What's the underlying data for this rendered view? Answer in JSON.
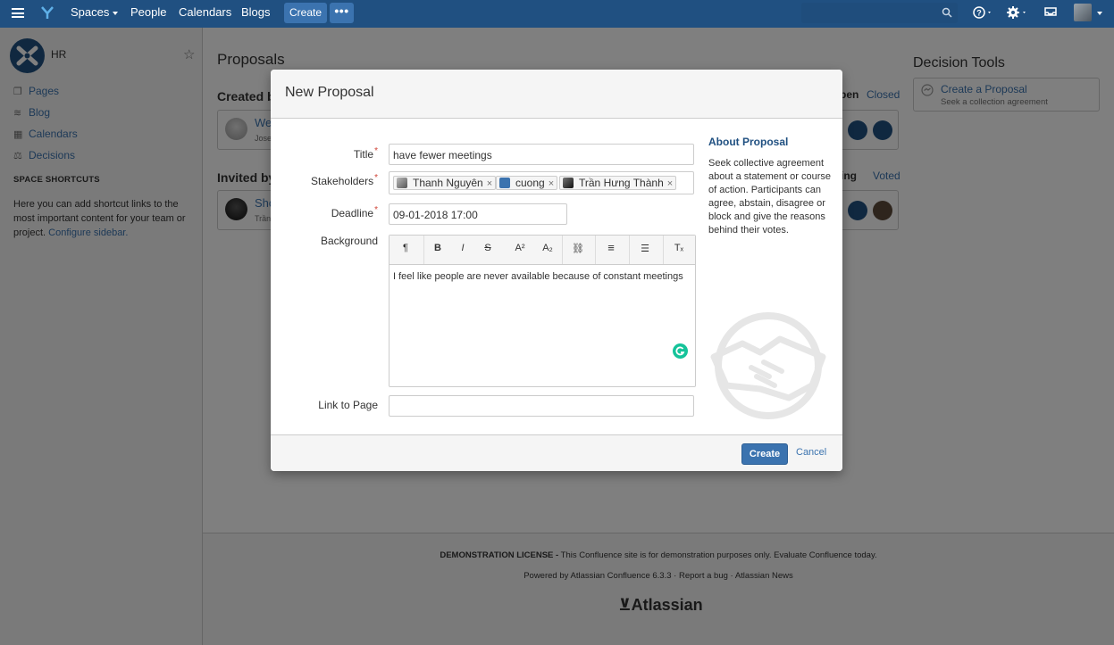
{
  "topbar": {
    "nav": [
      "Spaces",
      "People",
      "Calendars",
      "Blogs"
    ],
    "create_label": "Create",
    "more_label": "•••"
  },
  "sidebar": {
    "space_name": "HR",
    "links": [
      "Pages",
      "Blog",
      "Calendars",
      "Decisions"
    ],
    "shortcuts_heading": "SPACE SHORTCUTS",
    "shortcuts_text": "Here you can add shortcut links to the most important content for your team or project.",
    "configure_link": "Configure sidebar."
  },
  "main": {
    "title": "Proposals",
    "created_heading": "Created b",
    "created_filter_open": "pen",
    "created_filter_closed": "Closed",
    "created_card_title": "We",
    "created_card_sub": "Jose",
    "invited_heading": "Invited by",
    "invited_filter_waiting": "aiting",
    "invited_filter_voted": "Voted",
    "invited_card_title": "Sho",
    "invited_card_sub": "Trần"
  },
  "decision_tools": {
    "title": "Decision Tools",
    "item_title": "Create a Proposal",
    "item_sub": "Seek a collection agreement"
  },
  "footer": {
    "license_bold": "DEMONSTRATION LICENSE -",
    "license_text": " This Confluence site is for demonstration purposes only. Evaluate Confluence today.",
    "powered": "Powered by Atlassian Confluence 6.3.3",
    "report": "Report a bug",
    "news": "Atlassian News",
    "logo": "Atlassian"
  },
  "dialog": {
    "title": "New Proposal",
    "fields": {
      "title_label": "Title",
      "title_value": "have fewer meetings",
      "stakeholders_label": "Stakeholders",
      "stakeholders": [
        "Thanh Nguyên",
        "cuong",
        "Trần Hưng Thành"
      ],
      "deadline_label": "Deadline",
      "deadline_value": "09-01-2018 17:00",
      "background_label": "Background",
      "background_value": "I feel like people are never available because of constant meetings",
      "link_label": "Link to Page",
      "link_value": ""
    },
    "toolbar": {
      "paragraph": "¶",
      "bold": "B",
      "italic": "I",
      "strike": "S",
      "superscript": "A²",
      "subscript": "A₂",
      "link": "⛓",
      "align": "≡",
      "list": "☰",
      "clear": "Tₓ"
    },
    "about": {
      "title": "About Proposal",
      "text": "Seek collective agreement about a statement or course of action. Participants can agree, abstain, disagree or block and give the reasons behind their votes."
    },
    "create_button": "Create",
    "cancel_link": "Cancel"
  },
  "colors": {
    "header_blue": "#205081",
    "link_blue": "#3b73af",
    "required_red": "#d04437",
    "grammarly_green": "#15c39a"
  }
}
